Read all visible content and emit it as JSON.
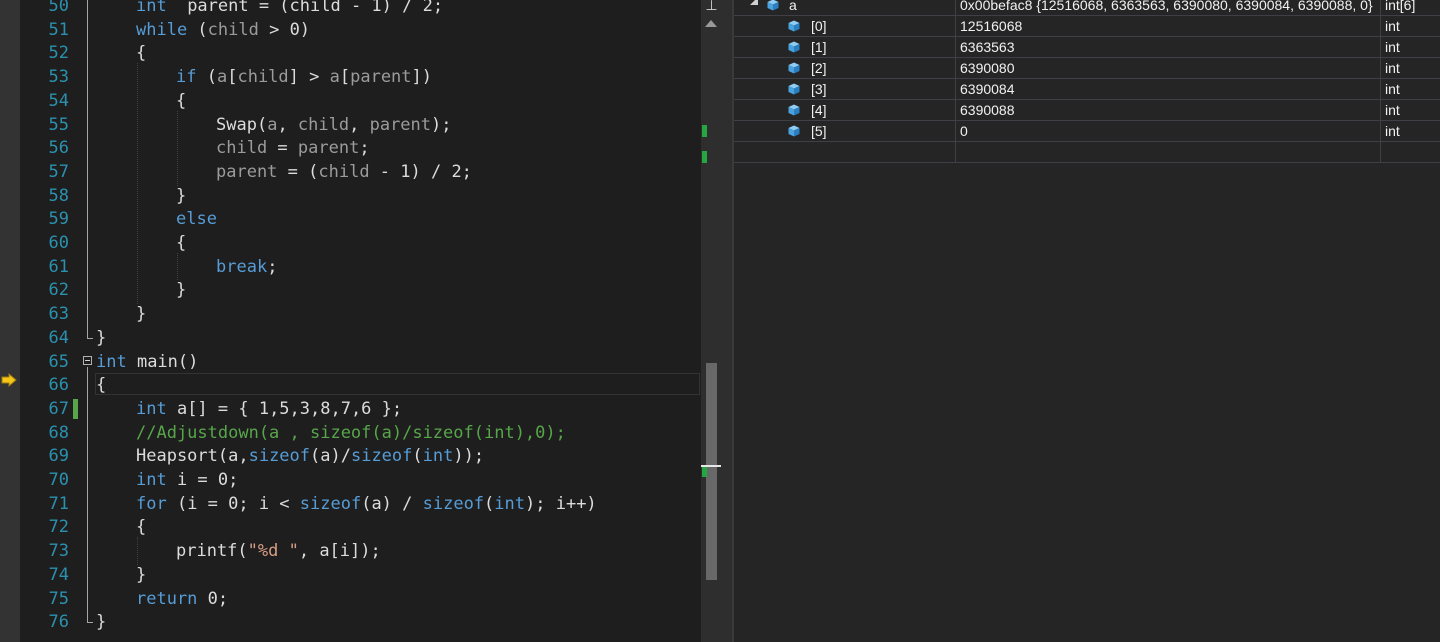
{
  "editor": {
    "lines": [
      {
        "n": "50",
        "tokens": [
          [
            "kw",
            "int"
          ],
          [
            "",
            "  parent = (child - 1) / 2;"
          ]
        ]
      },
      {
        "n": "51",
        "tokens": [
          [
            "kw",
            "while"
          ],
          [
            "",
            " ("
          ],
          [
            "dim",
            "child"
          ],
          [
            "",
            " > 0)"
          ]
        ]
      },
      {
        "n": "52",
        "tokens": [
          [
            "",
            "{"
          ]
        ]
      },
      {
        "n": "53",
        "tokens": [
          [
            "kw",
            "if"
          ],
          [
            "",
            " ("
          ],
          [
            "dim",
            "a"
          ],
          [
            "",
            "["
          ],
          [
            "dim",
            "child"
          ],
          [
            "",
            "] > "
          ],
          [
            "dim",
            "a"
          ],
          [
            "",
            "["
          ],
          [
            "dim",
            "parent"
          ],
          [
            "",
            "])"
          ]
        ]
      },
      {
        "n": "54",
        "tokens": [
          [
            "",
            "{"
          ]
        ]
      },
      {
        "n": "55",
        "tokens": [
          [
            "",
            "Swap("
          ],
          [
            "dim",
            "a"
          ],
          [
            "",
            ", "
          ],
          [
            "dim",
            "child"
          ],
          [
            "",
            ", "
          ],
          [
            "dim",
            "parent"
          ],
          [
            "",
            ");"
          ]
        ]
      },
      {
        "n": "56",
        "tokens": [
          [
            "dim",
            "child"
          ],
          [
            "",
            " = "
          ],
          [
            "dim",
            "parent"
          ],
          [
            "",
            ";"
          ]
        ]
      },
      {
        "n": "57",
        "tokens": [
          [
            "dim",
            "parent"
          ],
          [
            "",
            " = ("
          ],
          [
            "dim",
            "child"
          ],
          [
            "",
            " - 1) / 2;"
          ]
        ]
      },
      {
        "n": "58",
        "tokens": [
          [
            "",
            "}"
          ]
        ]
      },
      {
        "n": "59",
        "tokens": [
          [
            "kw",
            "else"
          ]
        ]
      },
      {
        "n": "60",
        "tokens": [
          [
            "",
            "{"
          ]
        ]
      },
      {
        "n": "61",
        "tokens": [
          [
            "kw",
            "break"
          ],
          [
            "",
            ";"
          ]
        ]
      },
      {
        "n": "62",
        "tokens": [
          [
            "",
            "}"
          ]
        ]
      },
      {
        "n": "63",
        "tokens": [
          [
            "",
            "}"
          ]
        ]
      },
      {
        "n": "64",
        "tokens": [
          [
            "",
            "}"
          ]
        ]
      },
      {
        "n": "65",
        "tokens": [
          [
            "kw",
            "int"
          ],
          [
            "",
            " main()"
          ]
        ]
      },
      {
        "n": "66",
        "tokens": [
          [
            "",
            "{"
          ]
        ]
      },
      {
        "n": "67",
        "tokens": [
          [
            "kw",
            "int"
          ],
          [
            "",
            " a[] = { 1,5,3,8,7,6 };"
          ]
        ]
      },
      {
        "n": "68",
        "tokens": [
          [
            "cm",
            "//Adjustdown(a , sizeof(a)/sizeof(int),0);"
          ]
        ]
      },
      {
        "n": "69",
        "tokens": [
          [
            "",
            "Heapsort(a,"
          ],
          [
            "kw",
            "sizeof"
          ],
          [
            "",
            "(a)/"
          ],
          [
            "kw",
            "sizeof"
          ],
          [
            "",
            "("
          ],
          [
            "kw",
            "int"
          ],
          [
            "",
            "));"
          ]
        ]
      },
      {
        "n": "70",
        "tokens": [
          [
            "kw",
            "int"
          ],
          [
            "",
            " i = 0;"
          ]
        ]
      },
      {
        "n": "71",
        "tokens": [
          [
            "kw",
            "for"
          ],
          [
            "",
            " (i = 0; i < "
          ],
          [
            "kw",
            "sizeof"
          ],
          [
            "",
            "(a) / "
          ],
          [
            "kw",
            "sizeof"
          ],
          [
            "",
            "("
          ],
          [
            "kw",
            "int"
          ],
          [
            "",
            "); i++)"
          ]
        ]
      },
      {
        "n": "72",
        "tokens": [
          [
            "",
            "{"
          ]
        ]
      },
      {
        "n": "73",
        "tokens": [
          [
            "",
            "printf("
          ],
          [
            "str",
            "\"%d \""
          ],
          [
            "",
            ", a[i]);"
          ]
        ]
      },
      {
        "n": "74",
        "tokens": [
          [
            "",
            "}"
          ]
        ]
      },
      {
        "n": "75",
        "tokens": [
          [
            "kw",
            "return"
          ],
          [
            "",
            " 0;"
          ]
        ]
      },
      {
        "n": "76",
        "tokens": [
          [
            "",
            "}"
          ]
        ]
      }
    ]
  },
  "scrollbar": {
    "split_glyph": "⊥",
    "position_fraction": 0.73
  },
  "watch": {
    "rows": [
      {
        "name": "a",
        "value": "0x00befac8 {12516068, 6363563, 6390080, 6390084, 6390088, 0}",
        "type": "int[6]",
        "expanded": true
      },
      {
        "name": "[0]",
        "value": "12516068",
        "type": "int"
      },
      {
        "name": "[1]",
        "value": "6363563",
        "type": "int"
      },
      {
        "name": "[2]",
        "value": "6390080",
        "type": "int"
      },
      {
        "name": "[3]",
        "value": "6390084",
        "type": "int"
      },
      {
        "name": "[4]",
        "value": "6390088",
        "type": "int"
      },
      {
        "name": "[5]",
        "value": "0",
        "type": "int"
      },
      {
        "name": "",
        "value": "",
        "type": ""
      }
    ]
  },
  "colors": {
    "keyword": "#569cd6",
    "identifier_dim": "#9b9b9b",
    "comment": "#57a64a",
    "string": "#d69d85",
    "line_number": "#2b91af",
    "change_marker": "#57a64a",
    "cube_icon": "#4aa3df",
    "instruction_pointer": "#f5c518"
  },
  "icons": {
    "instruction_pointer": "instruction-pointer-arrow-icon",
    "variable": "variable-cube-icon",
    "collapse": "collapse-minus-icon",
    "expand": "expanded-triangle-icon"
  }
}
